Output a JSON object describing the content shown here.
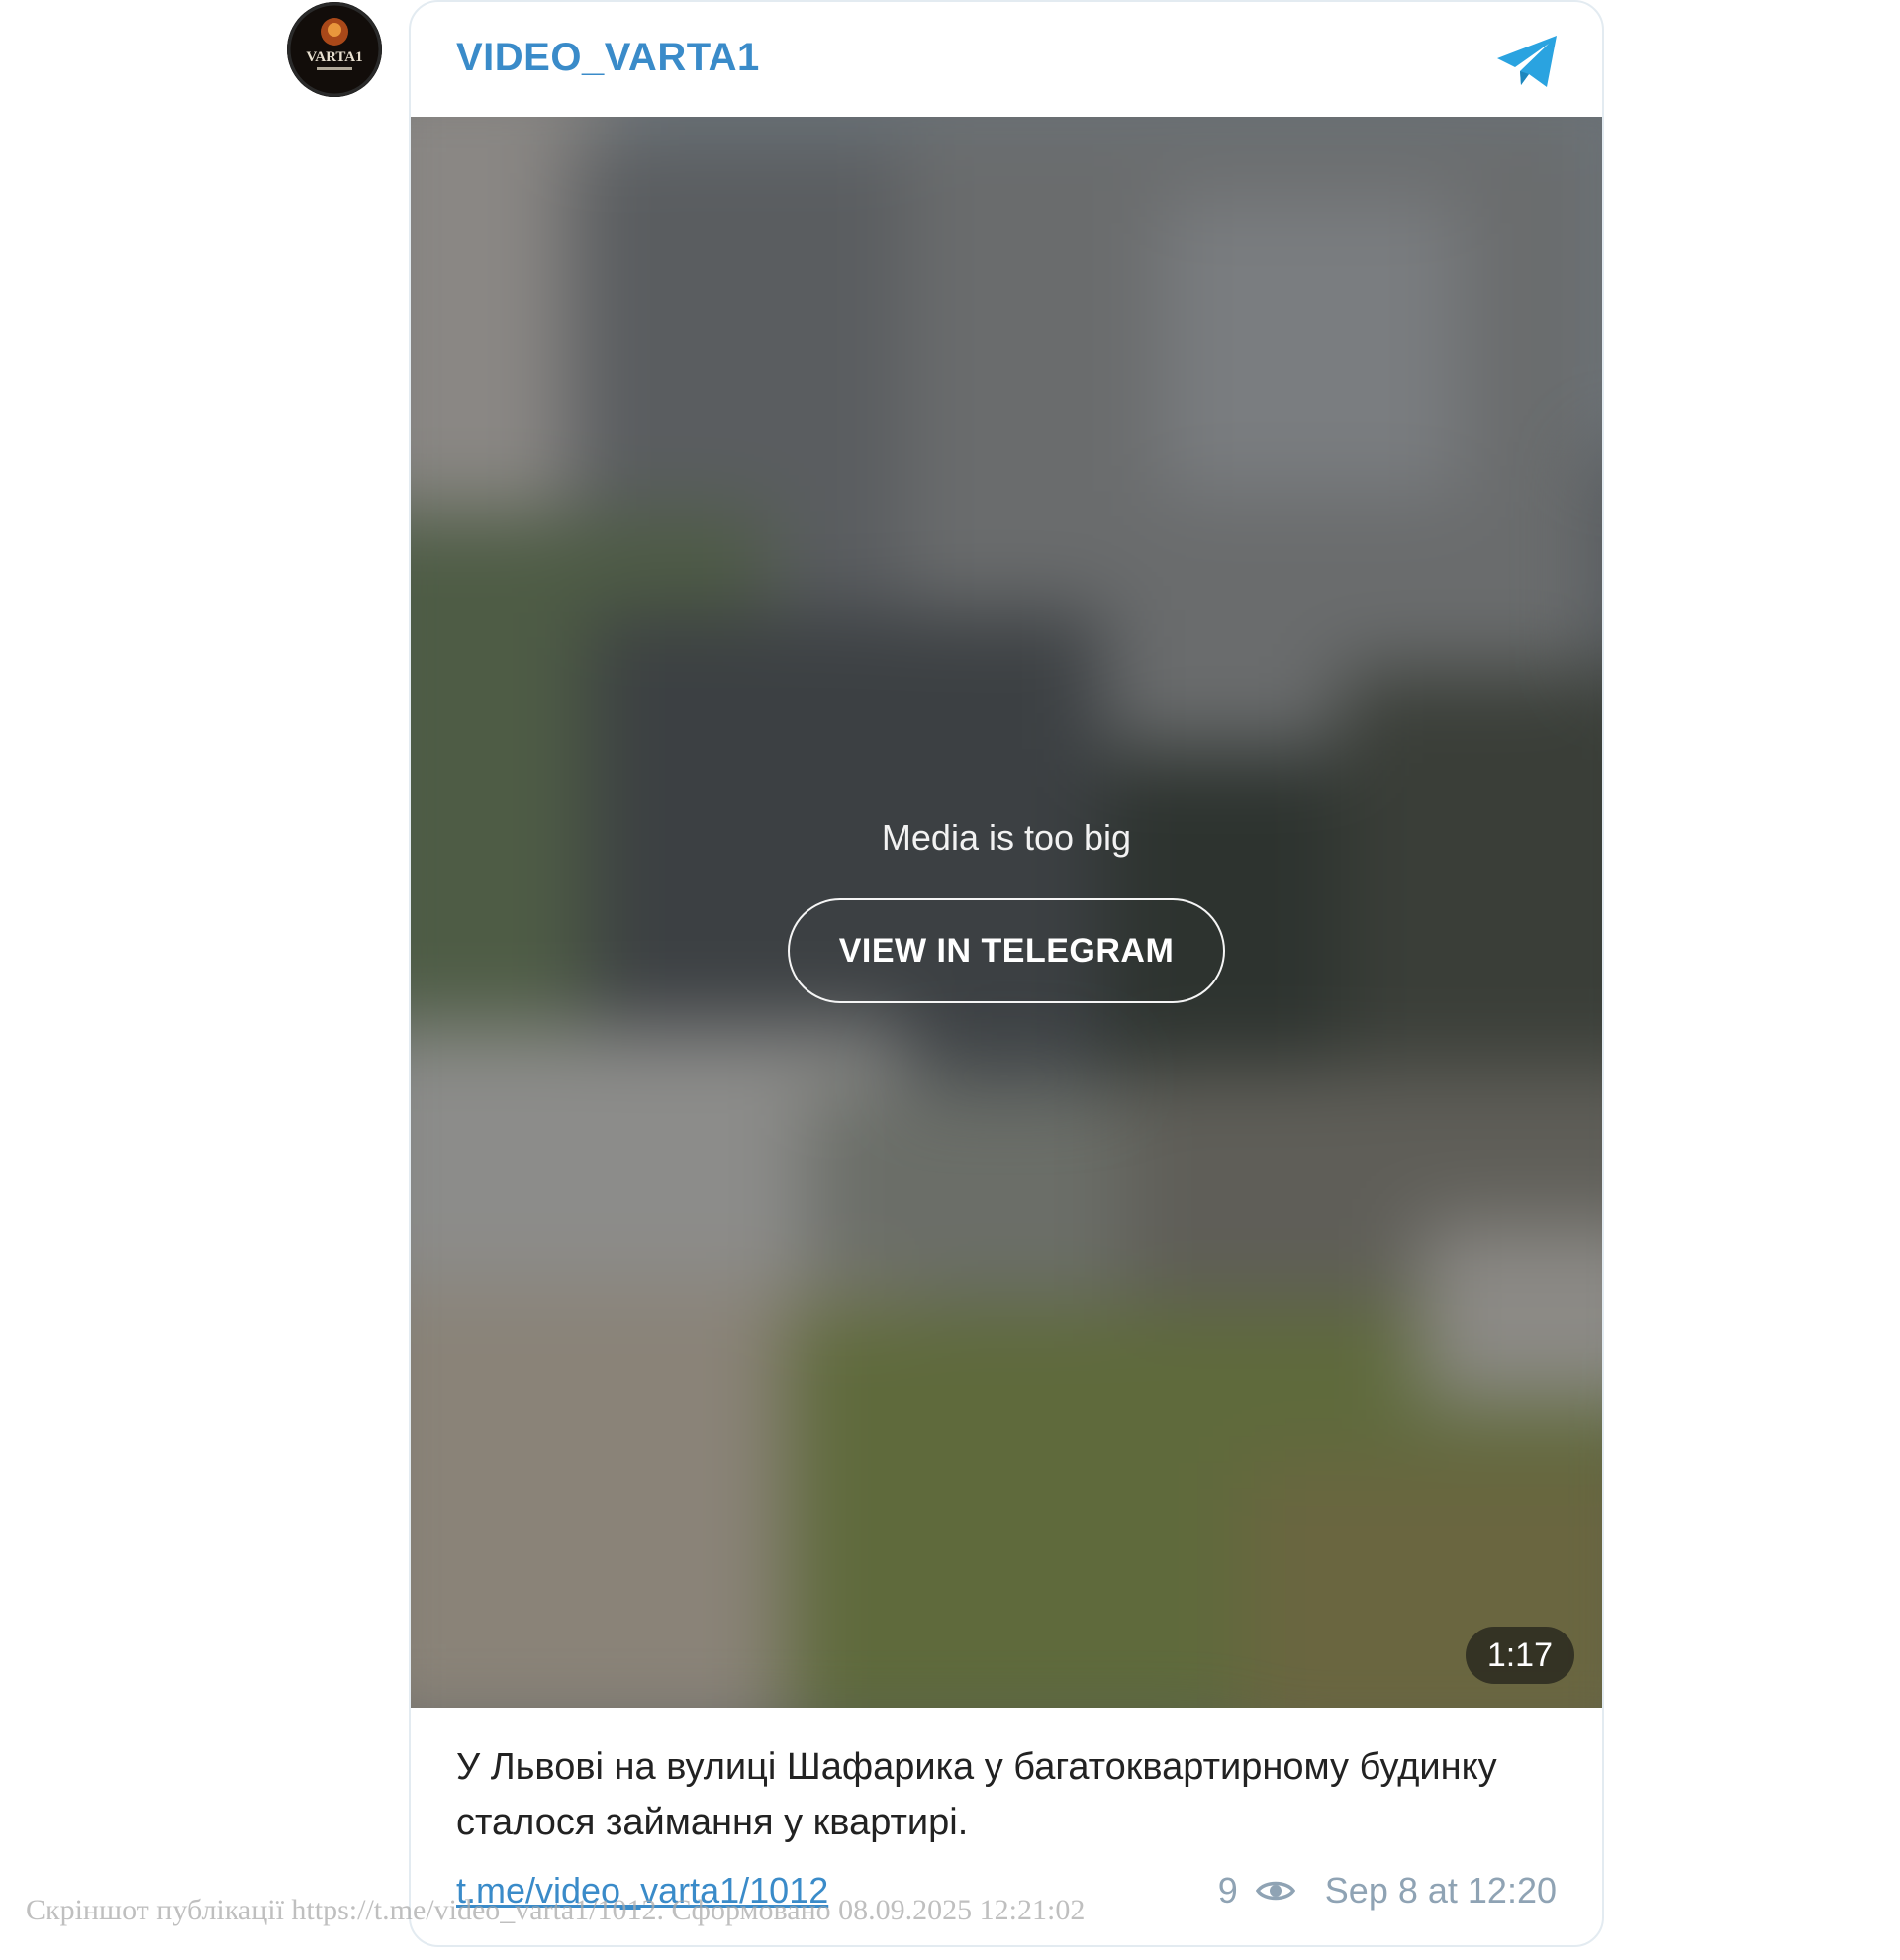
{
  "channel": {
    "name": "VIDEO_VARTA1",
    "avatar_text": "VARTA1"
  },
  "media": {
    "note": "Media is too big",
    "button_label": "VIEW IN TELEGRAM",
    "duration": "1:17"
  },
  "post": {
    "caption": "У Львові на вулиці Шафарика у багатоквартирному будинку сталося займання у квартирі.",
    "link": "t.me/video_varta1/1012",
    "views": "9",
    "date": "Sep 8 at 12:20"
  },
  "watermark": "Скріншот публікації https://t.me/video_varta1/1012. Сформовано 08.09.2025 12:21:02",
  "colors": {
    "accent": "#3a8bc9",
    "telegram": "#2aa3e0",
    "meta": "#8fa3b4"
  },
  "icons": {
    "header": "telegram-plane-icon",
    "views": "eye-icon"
  }
}
